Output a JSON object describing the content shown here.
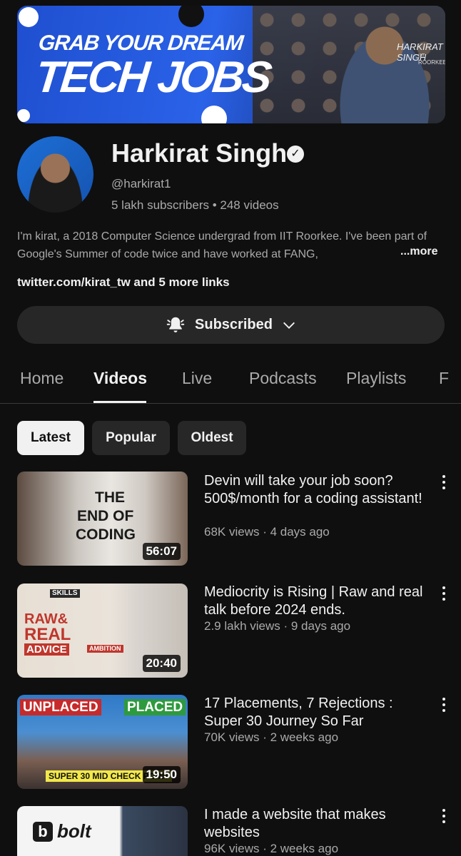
{
  "banner": {
    "line1": "GRAB YOUR DREAM",
    "line2": "TECH JOBS",
    "signature": "HARKIRAT SINGH",
    "signature_sub": "IIT ROORKEE"
  },
  "channel": {
    "name": "Harkirat Singh",
    "handle": "@harkirat1",
    "stats": "5 lakh subscribers • 248 videos",
    "description": "I'm kirat, a 2018 Computer Science undergrad from IIT Roorkee. I've been part of Google's Summer of code twice and have worked at FANG,",
    "more_label": "...more",
    "links": "twitter.com/kirat_tw and 5 more links",
    "subscribe_label": "Subscribed"
  },
  "tabs": [
    "Home",
    "Videos",
    "Live",
    "Podcasts",
    "Playlists",
    "F"
  ],
  "chips": [
    "Latest",
    "Popular",
    "Oldest"
  ],
  "videos": [
    {
      "title": "Devin will take your job soon? 500$/month for a coding assistant!",
      "meta": "68K views · 4 days ago",
      "duration": "56:07",
      "thumb_text": [
        "THE",
        "END OF",
        "CODING"
      ]
    },
    {
      "title": "Mediocrity is Rising | Raw and real talk before 2024 ends.",
      "meta": "2.9 lakh views · 9 days ago",
      "duration": "20:40",
      "thumb_text": [
        "SKILLS",
        "RAW&",
        "REAL",
        "ADVICE",
        "AMBITION"
      ]
    },
    {
      "title": "17 Placements, 7 Rejections : Super 30 Journey So Far",
      "meta": "70K views · 2 weeks ago",
      "duration": "19:50",
      "thumb_text": [
        "UNPLACED",
        "PLACED",
        "SUPER 30 MID CHECK POINT"
      ]
    },
    {
      "title": "I made a website that makes websites",
      "meta": "96K views · 2 weeks ago",
      "duration": "",
      "thumb_text": [
        "bolt"
      ]
    }
  ]
}
